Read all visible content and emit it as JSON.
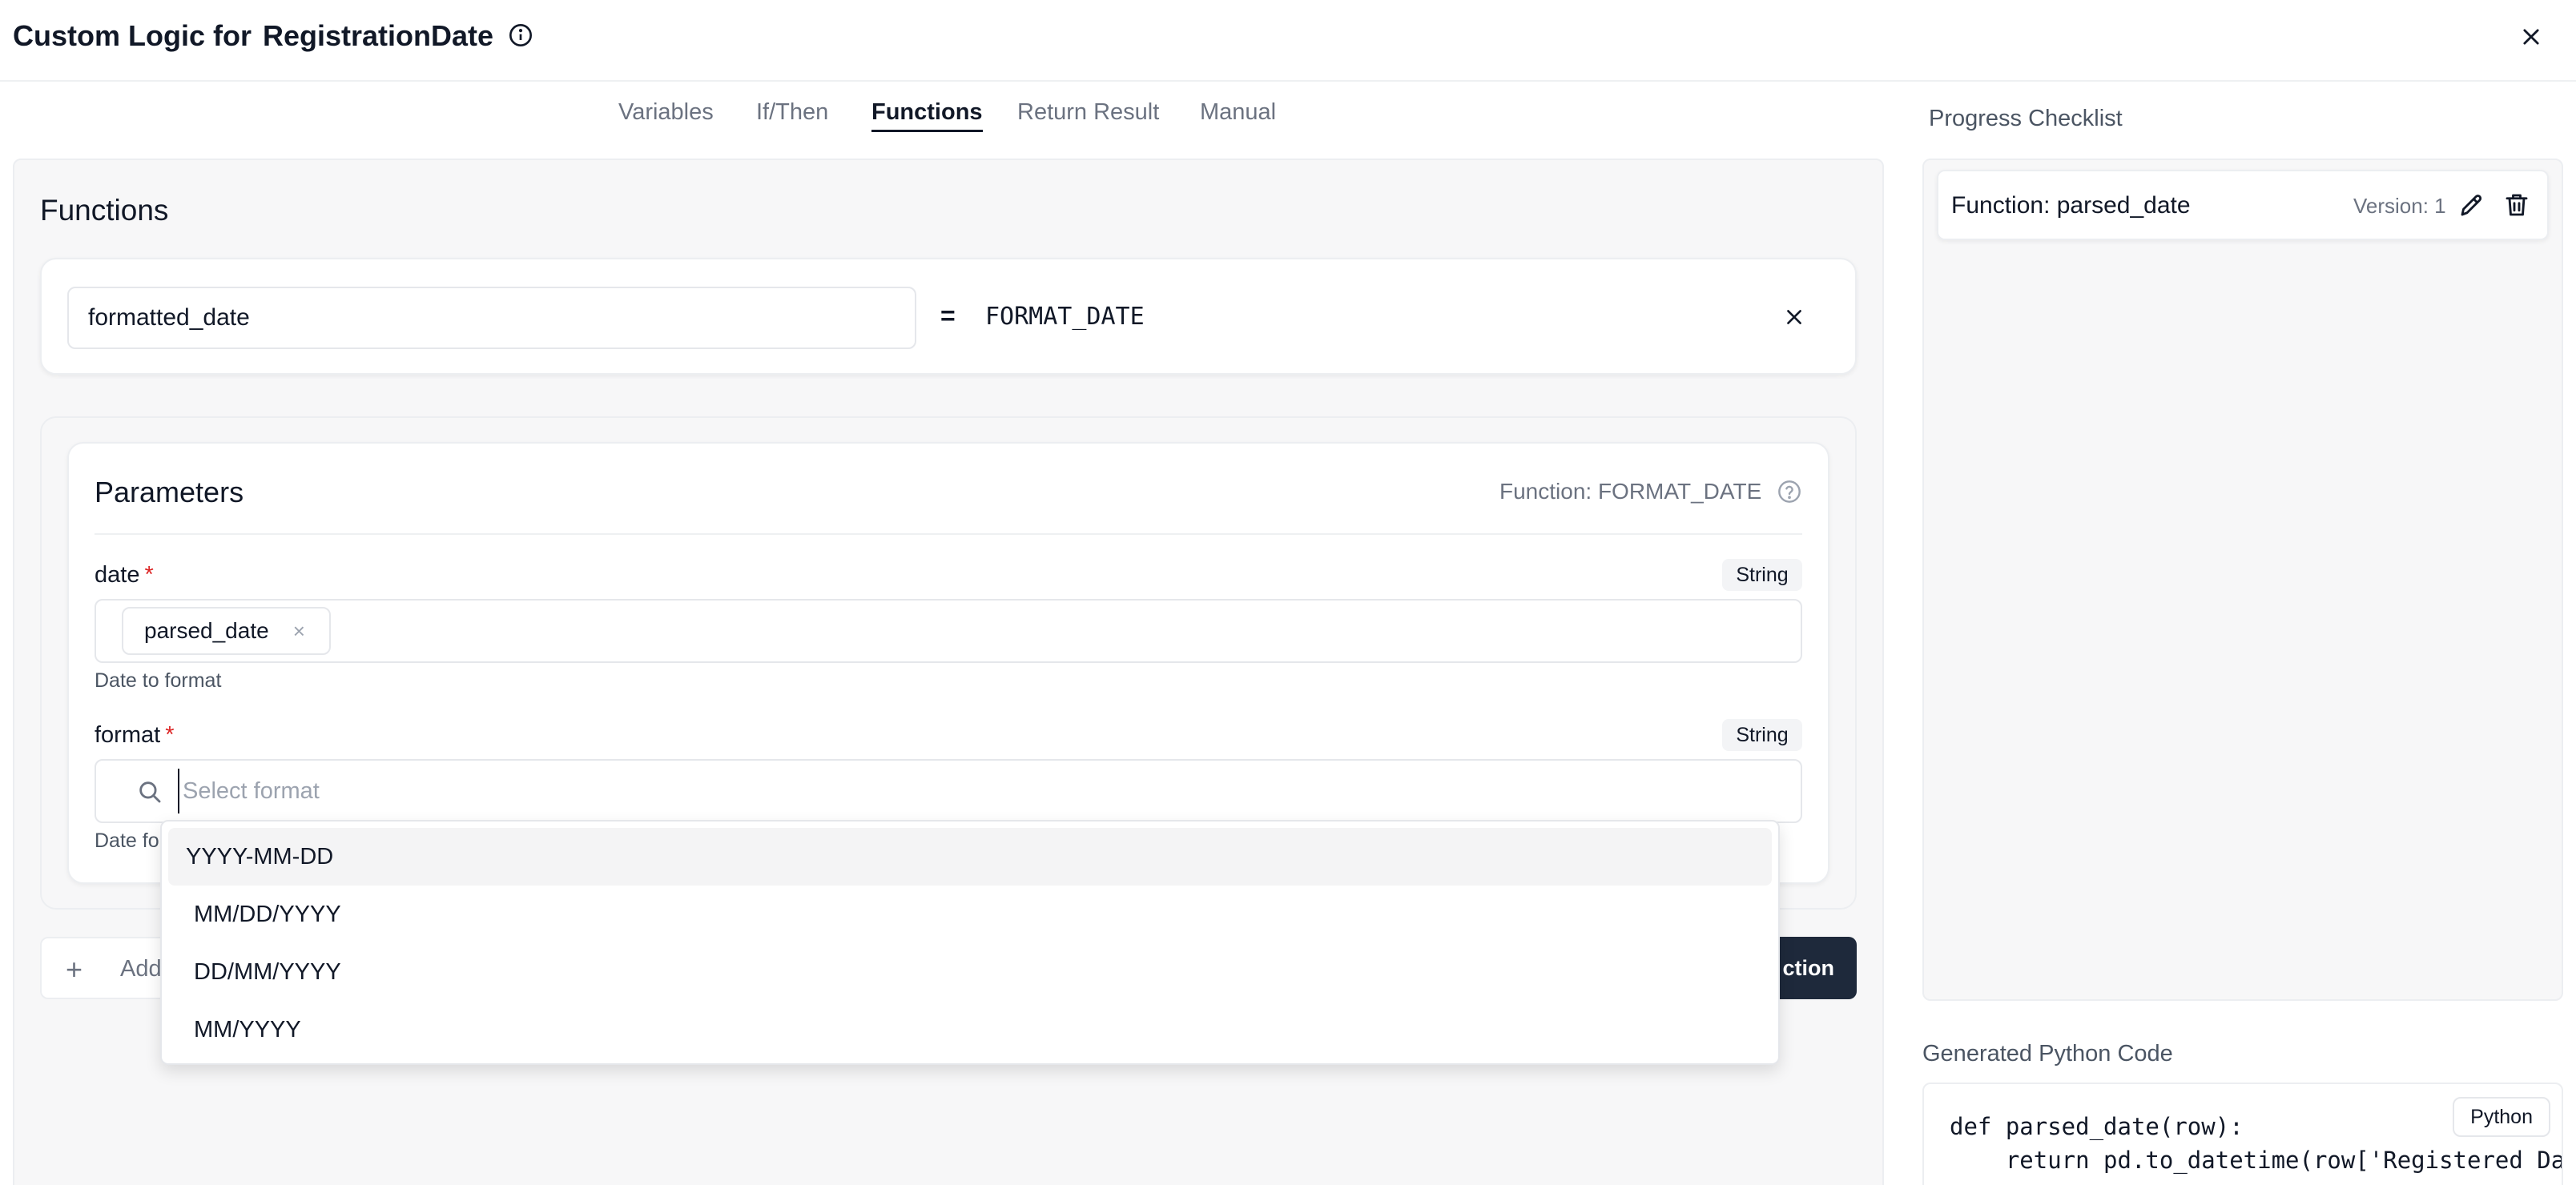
{
  "header": {
    "title_prefix": "Custom Logic for",
    "title_field": "RegistrationDate"
  },
  "tabs": [
    {
      "label": "Variables"
    },
    {
      "label": "If/Then"
    },
    {
      "label": "Functions",
      "active": true
    },
    {
      "label": "Return Result"
    },
    {
      "label": "Manual"
    }
  ],
  "functions": {
    "section_title": "Functions",
    "name_value": "formatted_date",
    "equals": "=",
    "function_name": "FORMAT_DATE"
  },
  "parameters": {
    "title": "Parameters",
    "function_label": "Function: FORMAT_DATE",
    "fields": [
      {
        "label": "date",
        "required_mark": "*",
        "type": "String",
        "chip": "parsed_date",
        "chip_remove": "×",
        "help": "Date to format"
      },
      {
        "label": "format",
        "required_mark": "*",
        "type": "String",
        "placeholder": "Select format",
        "help_visible": "Date fo"
      }
    ]
  },
  "format_dropdown": {
    "options": [
      "YYYY-MM-DD",
      "MM/DD/YYYY",
      "DD/MM/YYYY",
      "MM/YYYY"
    ],
    "highlighted_index": 0
  },
  "actions": {
    "add_plus": "+",
    "add_label_visible": "Add",
    "save_label_visible": "ction"
  },
  "progress": {
    "title": "Progress Checklist",
    "items": [
      {
        "label": "Function: parsed_date",
        "version": "Version: 1"
      }
    ]
  },
  "code": {
    "title": "Generated Python Code",
    "language": "Python",
    "lines": [
      "def parsed_date(row):",
      "    return pd.to_datetime(row['Registered Date"
    ]
  },
  "colors": {
    "primary_button": "#1e293b",
    "required": "#dc2626",
    "muted_text": "#6b7280"
  }
}
